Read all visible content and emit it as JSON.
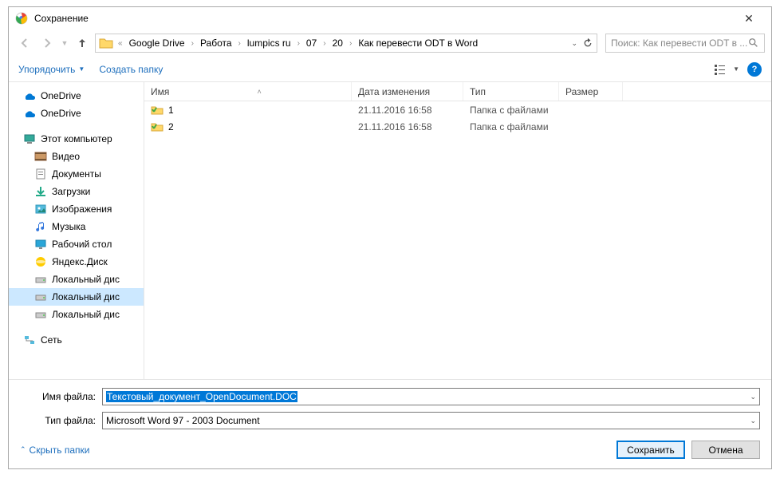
{
  "title": "Сохранение",
  "breadcrumb": {
    "prefix": "«",
    "items": [
      "Google Drive",
      "Работа",
      "lumpics ru",
      "07",
      "20",
      "Как перевести ODT в Word"
    ]
  },
  "nav": {
    "refresh_drop": "⌄"
  },
  "search": {
    "placeholder": "Поиск: Как перевести ODT в ..."
  },
  "toolbar": {
    "organize": "Упорядочить",
    "newfolder": "Создать папку"
  },
  "columns": {
    "name": "Имя",
    "date": "Дата изменения",
    "type": "Тип",
    "size": "Размер"
  },
  "rows": [
    {
      "name": "1",
      "date": "21.11.2016 16:58",
      "type": "Папка с файлами",
      "size": ""
    },
    {
      "name": "2",
      "date": "21.11.2016 16:58",
      "type": "Папка с файлами",
      "size": ""
    }
  ],
  "tree": [
    {
      "label": "OneDrive",
      "icon": "onedrive"
    },
    {
      "label": "OneDrive",
      "icon": "onedrive"
    },
    {
      "sep": true
    },
    {
      "label": "Этот компьютер",
      "icon": "pc",
      "bold": false
    },
    {
      "label": "Видео",
      "icon": "video",
      "child": true
    },
    {
      "label": "Документы",
      "icon": "docs",
      "child": true
    },
    {
      "label": "Загрузки",
      "icon": "down",
      "child": true
    },
    {
      "label": "Изображения",
      "icon": "pics",
      "child": true
    },
    {
      "label": "Музыка",
      "icon": "music",
      "child": true
    },
    {
      "label": "Рабочий стол",
      "icon": "desk",
      "child": true
    },
    {
      "label": "Яндекс.Диск",
      "icon": "ydisk",
      "child": true
    },
    {
      "label": "Локальный дис",
      "icon": "hdd",
      "child": true
    },
    {
      "label": "Локальный дис",
      "icon": "hdd",
      "child": true,
      "selected": true
    },
    {
      "label": "Локальный дис",
      "icon": "hdd",
      "child": true
    },
    {
      "sep": true
    },
    {
      "label": "Сеть",
      "icon": "net"
    }
  ],
  "filename_label": "Имя файла:",
  "filetype_label": "Тип файла:",
  "filename_value": "Текстовый_документ_OpenDocument.DOC",
  "filetype_value": "Microsoft Word 97 - 2003 Document",
  "hide_folders": "Скрыть папки",
  "btn_save": "Сохранить",
  "btn_cancel": "Отмена"
}
